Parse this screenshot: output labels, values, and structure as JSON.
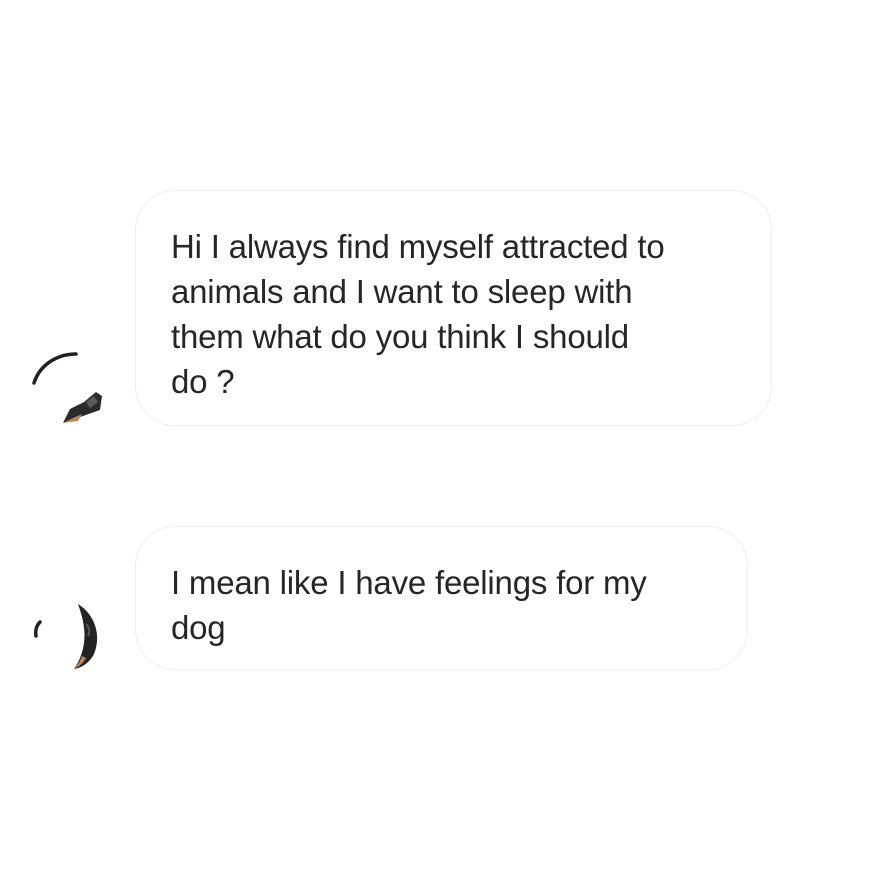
{
  "conversation": {
    "messages": [
      {
        "sender": "other",
        "avatar_icon": "profile-photo-icon",
        "text": "Hi I always find myself attracted to\nanimals and I want to sleep with\nthem what do you think I should\ndo ?"
      },
      {
        "sender": "other",
        "avatar_icon": "profile-photo-icon",
        "text": "I mean like I have feelings for my\ndog"
      }
    ]
  },
  "colors": {
    "background": "#ffffff",
    "bubble_border": "#efefef",
    "text": "#262626"
  }
}
